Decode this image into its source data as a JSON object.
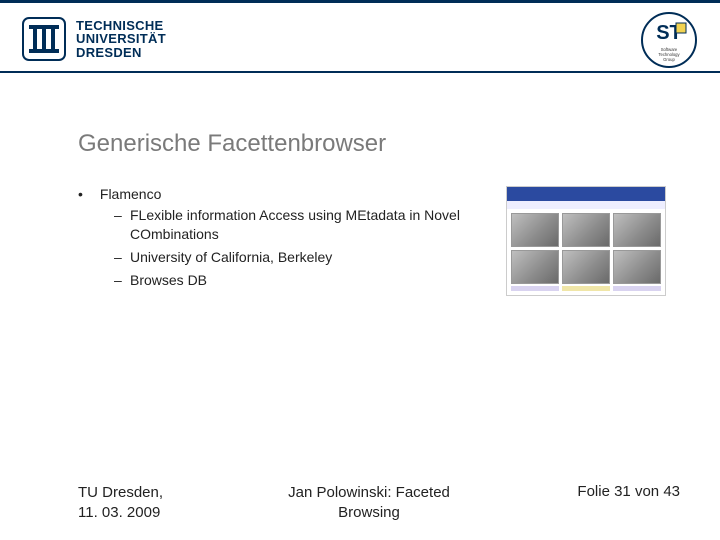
{
  "header": {
    "tud_lines": [
      "TECHNISCHE",
      "UNIVERSITÄT",
      "DRESDEN"
    ],
    "st_label": "ST",
    "st_sub": "Software Technology Group"
  },
  "title": "Generische Facettenbrowser",
  "bullets": {
    "main": "Flamenco",
    "subs": [
      "FLexible information Access using MEtadata in Novel COmbinations",
      "University of California, Berkeley",
      "Browses DB"
    ]
  },
  "footer": {
    "location": "TU Dresden,",
    "date": "11. 03. 2009",
    "talk_l1": "Jan Polowinski: Faceted",
    "talk_l2": "Browsing",
    "page_prefix": "Folie ",
    "page_num": "31",
    "page_sep": " von ",
    "page_total": "43"
  }
}
